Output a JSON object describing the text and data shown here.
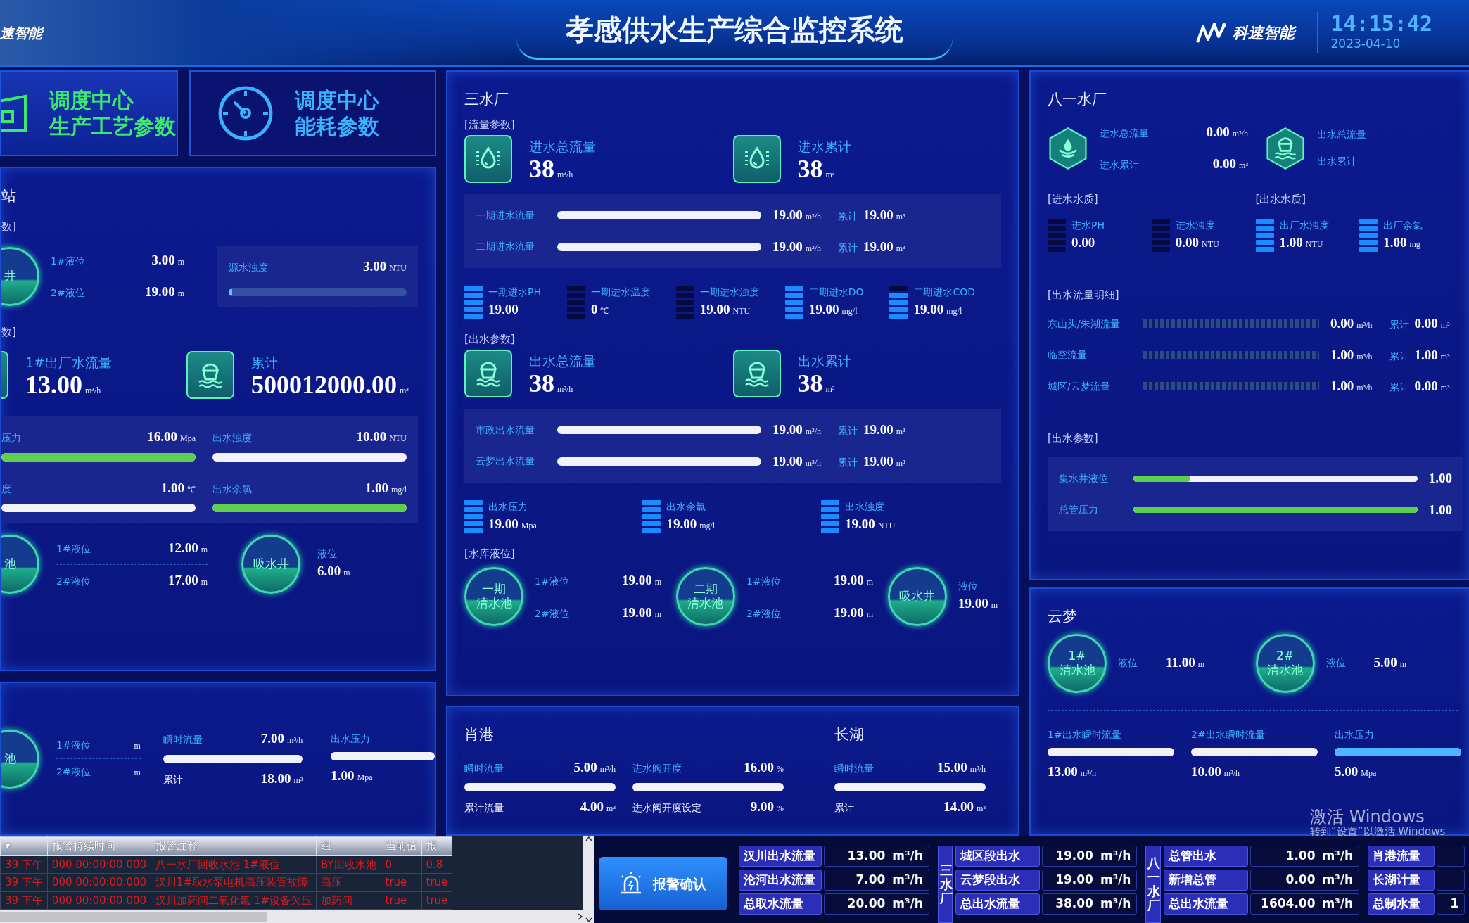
{
  "header": {
    "brand_left": "速智能",
    "title": "孝感供水生产综合监控系统",
    "brand_right": "科速智能",
    "time": "14:15:42",
    "date": "2023-04-10"
  },
  "nav_buttons": [
    {
      "line1": "调度中心",
      "line2": "生产工艺参数",
      "selected": true
    },
    {
      "line1": "调度中心",
      "line2": "能耗参数",
      "selected": false
    }
  ],
  "pump_station": {
    "title": "站",
    "source_heading": "数]",
    "tank_1": {
      "name_lines": [
        "井"
      ],
      "levels": [
        {
          "label": "1#液位",
          "value": "3.00",
          "unit": "m"
        },
        {
          "label": "2#液位",
          "value": "19.00",
          "unit": "m"
        }
      ]
    },
    "turbidity": {
      "label": "源水浊度",
      "value": "3.00",
      "unit": "NTU",
      "level": 0.02
    },
    "outlet_heading": "数]",
    "outlet_cards": [
      {
        "label": "1#出厂水流量",
        "value": "13.00",
        "unit": "m³/h"
      },
      {
        "label": "累计",
        "value": "500012000.00",
        "unit": "m³"
      }
    ],
    "bars": [
      {
        "label": "压力",
        "value": "16.00",
        "unit": "Mpa",
        "level": 1
      },
      {
        "label": "出水浊度",
        "value": "10.00",
        "unit": "NTU",
        "level": 0
      },
      {
        "label": "度",
        "value": "1.00",
        "unit": "℃",
        "level": 0
      },
      {
        "label": "出水余氯",
        "value": "1.00",
        "unit": "mg/l",
        "level": 1
      }
    ],
    "tank_2": {
      "name_lines": [
        "池"
      ],
      "levels": [
        {
          "label": "1#液位",
          "value": "12.00",
          "unit": "m"
        },
        {
          "label": "2#液位",
          "value": "17.00",
          "unit": "m"
        }
      ]
    },
    "suction_well": {
      "name_lines": [
        "吸水井"
      ],
      "label": "液位",
      "value": "6.00",
      "unit": "m"
    }
  },
  "station_2": {
    "tank": {
      "name_lines": [
        "池"
      ],
      "levels": [
        {
          "label": "1#液位",
          "unit": "m"
        },
        {
          "label": "2#液位",
          "unit": "m"
        }
      ]
    },
    "metrics": [
      {
        "label": "瞬时流量",
        "value": "7.00",
        "unit": "m³/h",
        "level": 0,
        "sub_label": "累计",
        "sub_value": "18.00",
        "sub_unit": "m³"
      },
      {
        "label": "出水压力",
        "level": 0,
        "sub_value": "1.00",
        "sub_unit": "Mpa"
      }
    ]
  },
  "sanshui": {
    "title": "三水厂",
    "inflow_heading": "[流量参数]",
    "inflow_cards": [
      {
        "label": "进水总流量",
        "value": "38",
        "unit": "m³/h"
      },
      {
        "label": "进水累计",
        "value": "38",
        "unit": "m³"
      }
    ],
    "inflow_bars": [
      {
        "label": "一期进水流量",
        "level": 0,
        "value": "19.00",
        "unit": "m³/h",
        "total_label": "累计",
        "total_value": "19.00",
        "total_unit": "m³"
      },
      {
        "label": "二期进水流量",
        "level": 0,
        "value": "19.00",
        "unit": "m³/h",
        "total_label": "累计",
        "total_value": "19.00",
        "total_unit": "m³"
      }
    ],
    "inflow_meters": [
      {
        "label": "一期进水PH",
        "value": "19.00",
        "segments": [
          true,
          true,
          true,
          true,
          true
        ]
      },
      {
        "label": "一期进水温度",
        "value": "0",
        "unit": "℃",
        "segments": [
          false,
          false,
          false,
          false,
          false
        ]
      },
      {
        "label": "一期进水浊度",
        "value": "19.00",
        "unit": "NTU",
        "segments": [
          false,
          false,
          false,
          false,
          false
        ]
      },
      {
        "label": "二期进水DO",
        "value": "19.00",
        "unit": "mg/l",
        "segments": [
          true,
          true,
          true,
          true,
          true
        ]
      },
      {
        "label": "二期进水COD",
        "value": "19.00",
        "unit": "mg/l",
        "segments": [
          false,
          true,
          true,
          true,
          true
        ]
      }
    ],
    "outflow_heading": "[出水参数]",
    "outflow_cards": [
      {
        "label": "出水总流量",
        "value": "38",
        "unit": "m³/h"
      },
      {
        "label": "出水累计",
        "value": "38",
        "unit": "m³"
      }
    ],
    "outflow_bars": [
      {
        "label": "市政出水流量",
        "level": 0,
        "value": "19.00",
        "unit": "m³/h",
        "total_label": "累计",
        "total_value": "19.00",
        "total_unit": "m³"
      },
      {
        "label": "云梦出水流量",
        "level": 0,
        "value": "19.00",
        "unit": "m³/h",
        "total_label": "累计",
        "total_value": "19.00",
        "total_unit": "m³"
      }
    ],
    "outflow_meters": [
      {
        "label": "出水压力",
        "value": "19.00",
        "unit": "Mpa",
        "segments": [
          true,
          true,
          true,
          true,
          true
        ]
      },
      {
        "label": "出水余氯",
        "value": "19.00",
        "unit": "mg/l",
        "segments": [
          true,
          true,
          true,
          true,
          true
        ]
      },
      {
        "label": "出水浊度",
        "value": "19.00",
        "unit": "NTU",
        "segments": [
          true,
          true,
          true,
          true,
          true
        ]
      }
    ],
    "reservoir_heading": "[水库液位]",
    "tanks": [
      {
        "kind": "dual",
        "name_lines": [
          "一期",
          "清水池"
        ],
        "levels": [
          {
            "label": "1#液位",
            "value": "19.00",
            "unit": "m"
          },
          {
            "label": "2#液位",
            "value": "19.00",
            "unit": "m"
          }
        ]
      },
      {
        "kind": "dual",
        "name_lines": [
          "二期",
          "清水池"
        ],
        "levels": [
          {
            "label": "1#液位",
            "value": "19.00",
            "unit": "m"
          },
          {
            "label": "2#液位",
            "value": "19.00",
            "unit": "m"
          }
        ]
      },
      {
        "kind": "single",
        "name_lines": [
          "吸水井"
        ],
        "label": "液位",
        "value": "19.00",
        "unit": "m"
      }
    ]
  },
  "bottom_stations": [
    {
      "title": "肖港",
      "metrics": [
        {
          "label": "瞬时流量",
          "value": "5.00",
          "unit": "m³/h",
          "level": 0,
          "sub_label": "累计流量",
          "sub_value": "4.00",
          "sub_unit": "m³"
        },
        {
          "label": "进水阀开度",
          "value": "16.00",
          "unit": "%",
          "level": 0,
          "sub_label": "进水阀开度设定",
          "sub_value": "9.00",
          "sub_unit": "%"
        }
      ]
    },
    {
      "title": "长湖",
      "metrics": [
        {
          "label": "瞬时流量",
          "value": "15.00",
          "unit": "m³/h",
          "level": 0,
          "sub_label": "累计",
          "sub_value": "14.00",
          "sub_unit": "m³"
        }
      ]
    }
  ],
  "bayi": {
    "title": "八一水厂",
    "hex_groups": [
      {
        "rows": [
          {
            "label": "进水总流量",
            "value": "0.00",
            "unit": "m³/h"
          },
          {
            "label": "进水累计",
            "value": "0.00",
            "unit": "m³"
          }
        ]
      },
      {
        "rows": [
          {
            "label": "出水总流量"
          },
          {
            "label": "出水累计"
          }
        ]
      }
    ],
    "quality": [
      {
        "heading": "[进水水质]",
        "meters": [
          {
            "label": "进水PH",
            "value": "0.00",
            "segments": [
              false,
              false,
              false,
              false,
              false
            ]
          },
          {
            "label": "进水浊度",
            "value": "0.00",
            "unit": "NTU",
            "segments": [
              false,
              false,
              false,
              false,
              false
            ]
          }
        ]
      },
      {
        "heading": "[出水水质]",
        "meters": [
          {
            "label": "出厂水浊度",
            "value": "1.00",
            "unit": "NTU",
            "segments": [
              true,
              true,
              true,
              true,
              true
            ]
          },
          {
            "label": "出厂余氯",
            "value": "1.00",
            "unit": "mg",
            "segments": [
              true,
              true,
              true,
              true,
              true
            ]
          }
        ]
      }
    ],
    "detail_heading": "[出水流量明细]",
    "details": [
      {
        "label": "东山头/朱湖流量",
        "level": 0,
        "value": "0.00",
        "unit": "m³/h",
        "total_label": "累计",
        "total_value": "0.00",
        "total_unit": "m³"
      },
      {
        "label": "临空流量",
        "level": 0,
        "value": "1.00",
        "unit": "m³/h",
        "total_label": "累计",
        "total_value": "1.00",
        "total_unit": "m³"
      },
      {
        "label": "城区/云梦流量",
        "level": 0,
        "value": "1.00",
        "unit": "m³/h",
        "total_label": "累计",
        "total_value": "0.00",
        "total_unit": "m³"
      }
    ],
    "param_heading": "[出水参数]",
    "params": [
      {
        "label": "集水井液位",
        "level": 0.2,
        "value": "1.00"
      },
      {
        "label": "总管压力",
        "level": 1,
        "value": "1.00"
      }
    ]
  },
  "yunmeng": {
    "title": "云梦",
    "tanks": [
      {
        "name_lines": [
          "1#",
          "清水池"
        ],
        "label": "液位",
        "value": "11.00",
        "unit": "m"
      },
      {
        "name_lines": [
          "2#",
          "清水池"
        ],
        "label": "液位",
        "value": "5.00",
        "unit": "m"
      }
    ],
    "metrics": [
      {
        "label": "1#出水瞬时流量",
        "value": "13.00",
        "unit": "m³/h",
        "level": 0
      },
      {
        "label": "2#出水瞬时流量",
        "value": "10.00",
        "unit": "m³/h",
        "level": 0
      },
      {
        "label": "出水压力",
        "value": "5.00",
        "unit": "Mpa",
        "level": 1
      }
    ]
  },
  "alarm_table": {
    "columns": [
      "▾",
      "报警持续时间",
      "报警注释",
      "组",
      "当前值",
      "报"
    ],
    "rows": [
      [
        "39 下午",
        "000 00:00:00.000",
        "八一水厂回收水池 1#液位",
        "BY回收水池",
        "0",
        "0.8"
      ],
      [
        "39 下午",
        "000 00:00:00.000",
        "汉川1#取水泵电机高压装置故障",
        "高压",
        "true",
        "true"
      ],
      [
        "39 下午",
        "000 00:00:00.000",
        "汉川加药间二氧化氯 1#设备欠压",
        "加药间",
        "true",
        "true"
      ]
    ]
  },
  "alarm_confirm": {
    "label": "报警确认"
  },
  "summary": {
    "groups": [
      {
        "rows": [
          {
            "label": "汉川出水流量",
            "value": "13.00",
            "unit": "m³/h"
          },
          {
            "label": "沦河出水流量",
            "value": "7.00",
            "unit": "m³/h"
          },
          {
            "label": "总取水流量",
            "value": "20.00",
            "unit": "m³/h"
          }
        ]
      },
      {
        "side_label": "三水厂",
        "rows": [
          {
            "label": "城区段出水",
            "value": "19.00",
            "unit": "m³/h"
          },
          {
            "label": "云梦段出水",
            "value": "19.00",
            "unit": "m³/h"
          },
          {
            "label": "总出水流量",
            "value": "38.00",
            "unit": "m³/h"
          }
        ]
      },
      {
        "side_label": "八一水厂",
        "rows": [
          {
            "label": "总管出水",
            "value": "1.00",
            "unit": "m³/h"
          },
          {
            "label": "新增总管",
            "value": "0.00",
            "unit": "m³/h"
          },
          {
            "label": "总出水流量",
            "value": "1604.00",
            "unit": "m³/h"
          }
        ]
      },
      {
        "rows": [
          {
            "label": "肖港流量"
          },
          {
            "label": "长湖计量"
          },
          {
            "label": "总制水量",
            "value": "1"
          }
        ]
      }
    ]
  },
  "os_notice": {
    "title": "激活 Windows",
    "hint": "转到“设置”以激活 Windows"
  }
}
